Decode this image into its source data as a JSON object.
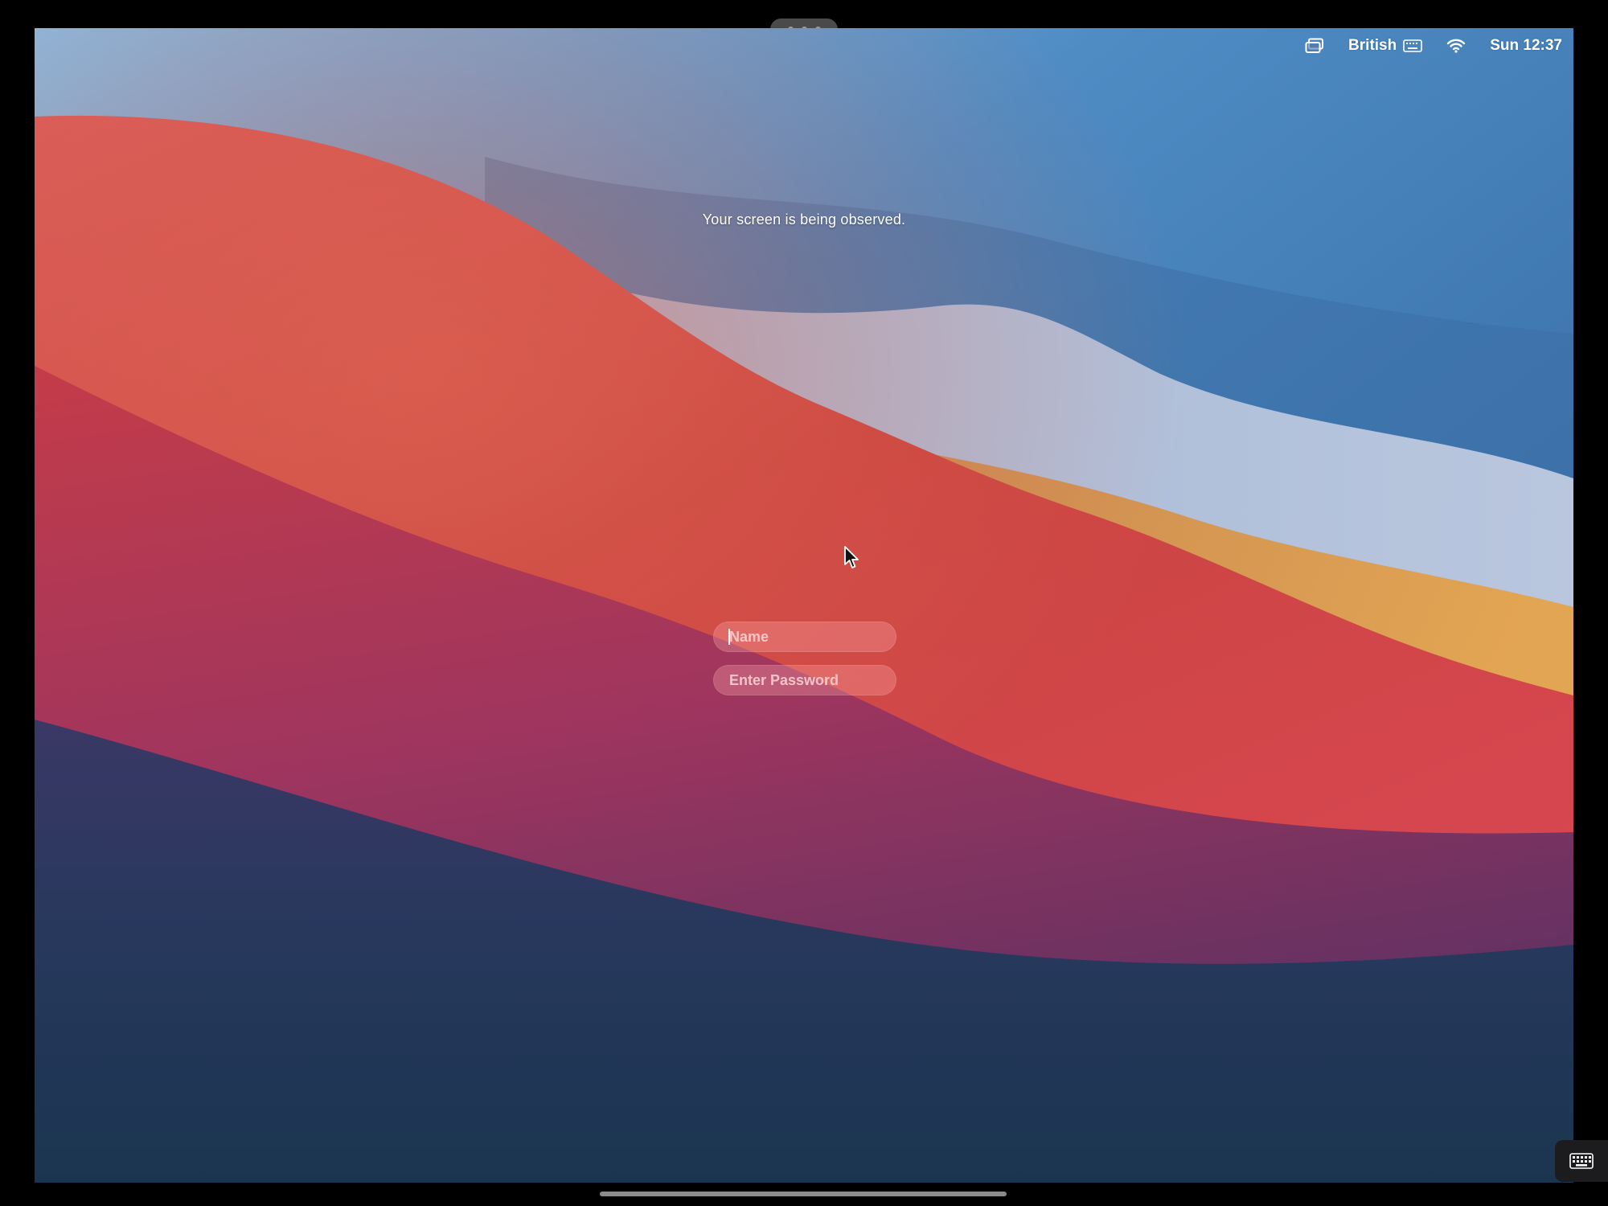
{
  "menubar": {
    "screen_icon": "screen-mirroring-icon",
    "input_source": "British",
    "keyboard_icon": "keyboard-icon",
    "wifi_icon": "wifi-icon",
    "clock": "Sun 12:37"
  },
  "banner": {
    "text": "Your screen is being observed."
  },
  "login": {
    "name_placeholder": "Name",
    "password_placeholder": "Enter Password"
  },
  "controls": {
    "handle_icon": "more-dots-icon",
    "keyboard_toggle_icon": "keyboard-icon",
    "home_indicator_icon": "home-indicator"
  },
  "colors": {
    "sky_blue": "#2a5e96",
    "wave_red": "#d24a48",
    "wave_orange": "#e0a24e",
    "deep_navy": "#1e3550"
  }
}
